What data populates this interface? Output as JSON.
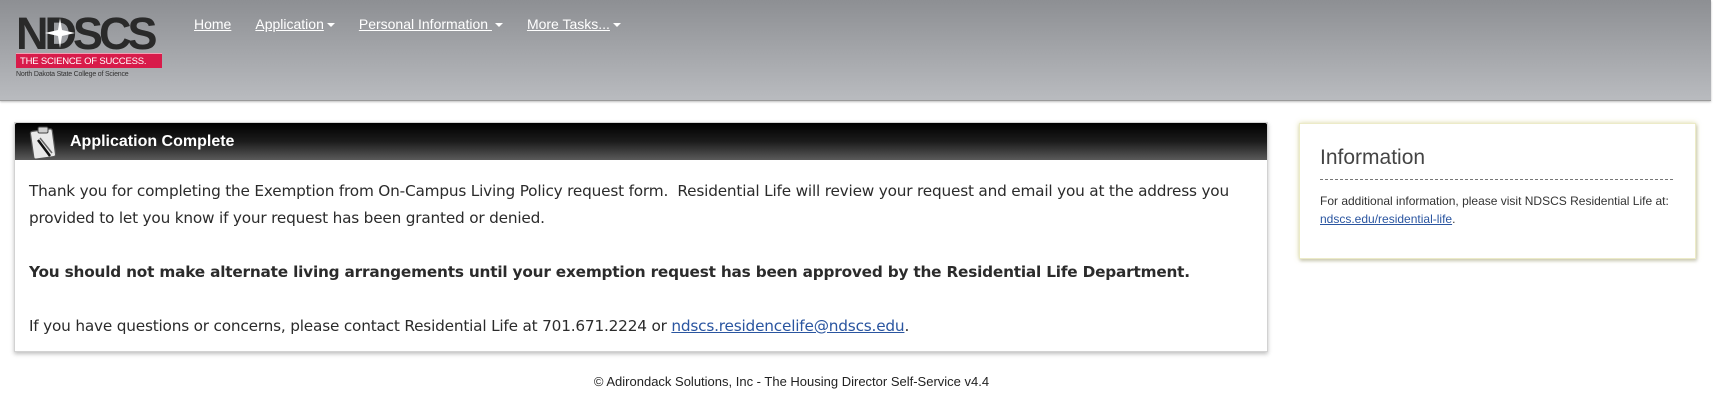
{
  "header": {
    "logo": {
      "wordmark": "NDSCS",
      "tagline": "THE SCIENCE OF SUCCESS.",
      "subtitle": "North Dakota State College of Science"
    },
    "nav": [
      {
        "label": "Home",
        "has_dropdown": false
      },
      {
        "label": "Application",
        "has_dropdown": true
      },
      {
        "label": "Personal Information ",
        "has_dropdown": true
      },
      {
        "label": "More Tasks...",
        "has_dropdown": true
      }
    ]
  },
  "panel": {
    "icon": "clipboard-icon",
    "title": "Application Complete",
    "para1": "Thank you for completing the Exemption from On-Campus Living Policy request form.  Residential Life will review your request and email you at the address you provided to let you know if your request has been granted or denied.",
    "para2": "You should not make alternate living arrangements until your exemption request has been approved by the Residential Life Department.",
    "para3_prefix": "If you have questions or concerns, please contact Residential Life at 701.671.2224 or ",
    "para3_link": "ndscs.residencelife@ndscs.edu",
    "para3_suffix": "."
  },
  "info": {
    "title": "Information",
    "text_prefix": "For additional information, please visit NDSCS Residential Life at: ",
    "link": "ndscs.edu/residential-life",
    "text_suffix": "."
  },
  "footer": {
    "text": "© Adirondack Solutions, Inc - The Housing Director Self-Service v4.4"
  },
  "colors": {
    "header_top": "#8d8f93",
    "brand_red": "#d81b4a",
    "link_blue": "#2a55a0"
  }
}
